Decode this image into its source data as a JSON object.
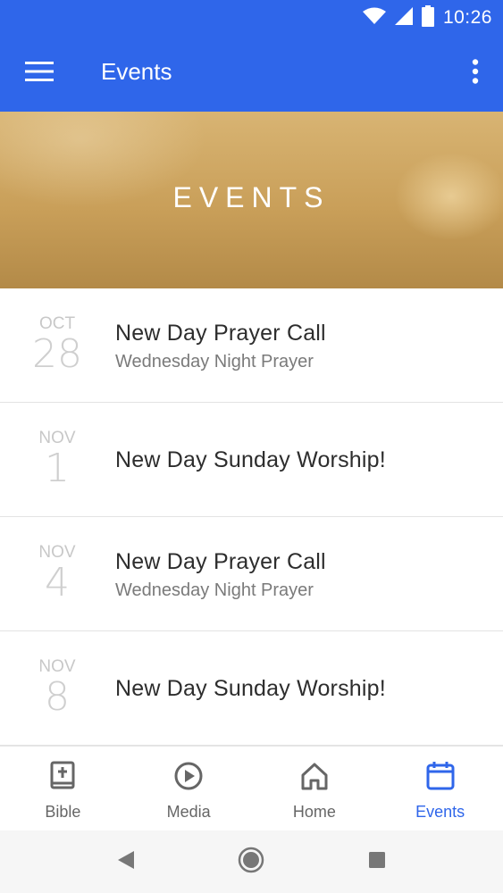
{
  "status_bar": {
    "time": "10:26"
  },
  "app_bar": {
    "title": "Events"
  },
  "hero": {
    "title": "EVENTS"
  },
  "events": [
    {
      "month": "OCT",
      "day": "28",
      "title": "New Day Prayer Call",
      "subtitle": "Wednesday Night Prayer"
    },
    {
      "month": "NOV",
      "day": "1",
      "title": "New Day Sunday Worship!",
      "subtitle": ""
    },
    {
      "month": "NOV",
      "day": "4",
      "title": "New Day Prayer Call",
      "subtitle": "Wednesday Night Prayer"
    },
    {
      "month": "NOV",
      "day": "8",
      "title": "New Day Sunday Worship!",
      "subtitle": ""
    }
  ],
  "bottom_nav": {
    "items": [
      {
        "label": "Bible",
        "icon": "bible-icon"
      },
      {
        "label": "Media",
        "icon": "play-circle-icon"
      },
      {
        "label": "Home",
        "icon": "home-icon"
      },
      {
        "label": "Events",
        "icon": "calendar-icon",
        "active": true
      }
    ]
  },
  "colors": {
    "primary": "#2f66ea",
    "hero_tint": "#c99f59",
    "date_gray": "#c8c8c8"
  }
}
